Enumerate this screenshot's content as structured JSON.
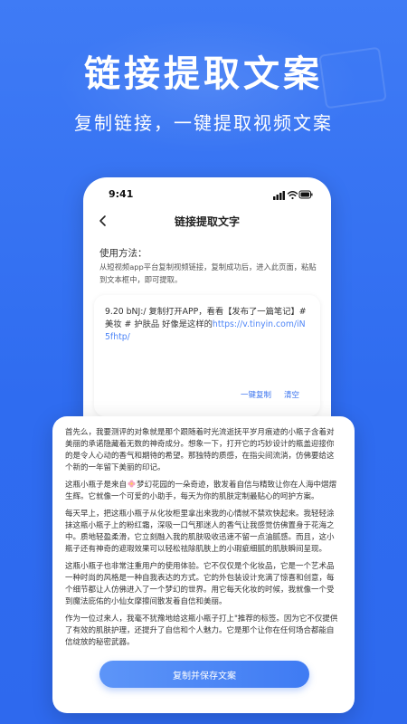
{
  "hero": {
    "title": "链接提取文案",
    "subtitle": "复制链接，一键提取视频文案"
  },
  "phone": {
    "status_time": "9:41",
    "nav_title": "链接提取文字",
    "howto_label": "使用方法：",
    "howto_text": "从短视频app平台复制视频链接，复制成功后，进入此页面，粘贴到文本框中，即可提取。",
    "input": {
      "text": "9.20 bNJ:/ 复制打开APP，看看【发布了一篇笔记】# 美妆 # 护肤品 好像是这样的",
      "link": "https://v.tinyin.com/iN5fhtp/"
    },
    "onekey_copy_label": "一键复制",
    "clear_label": "清空"
  },
  "result": {
    "p1": "首先么，我要测评的对象就是那个跟随着时光流逝抚平岁月痕迹的小瓶子含着对美丽的承诺隐藏着无数的神奇成分。想象一下，打开它的巧妙设计的瓶盖迎接你的是令人心动的香气和期待的希望。那独特的质感，在指尖间流淌，仿佛要给这个新的一年留下美丽的印记。",
    "p2_a": "这瓶小瓶子是来自",
    "p2_b": "梦幻花园的一朵奇迹，散发着自信与精致让你在人海中熠熠生辉。它就像一个可爱的小助手，每天为你的肌肤定制最贴心的呵护方案。",
    "p3": "每天早上，把这瓶小瓶子从化妆柜里拿出来我的心情就不禁欢快起来。我轻轻涂抹这瓶小瓶子上的粉红霜，深吸一口气那迷人的香气让我感觉仿佛置身于花海之中。质地轻盈柔滑，它立刻融入我的肌肤吸收迅速不留一点油腻感。而且，这小瓶子还有神奇的遮瑕效果可以轻松祛除肌肤上的小瑕疵细腻的肌肤瞬间呈现。",
    "p4": "这瓶小瓶子也非常注重用户的使用体验。它不仅仅是个化妆品，它是一个艺术品一种时尚的风格是一种自我表达的方式。它的外包装设计充满了惊喜和创意，每个细节都让人仿佛进入了一个梦幻的世界。用它每天化妆的时候，我就像一个受到魔法庇佑的小仙女摩擦间散发着自信和美丽。",
    "p5": "作为一位过来人，我毫不犹豫地给这瓶小瓶子打上\"推荐的标签。因为它不仅提供了有效的肌肤护理，还提升了自信和个人魅力。它是那个让你在任何场合都能自信绽放的秘密武器。",
    "save_button_label": "复制并保存文案"
  },
  "colors": {
    "background": "#3f7bf5",
    "accent": "#3b74ef",
    "link": "#4f86f7",
    "button_start": "#5d95f8",
    "button_end": "#3f7bf3"
  },
  "icons": [
    "back-chevron-icon",
    "signal-icon",
    "wifi-icon",
    "battery-icon",
    "flower-emoji-icon"
  ]
}
